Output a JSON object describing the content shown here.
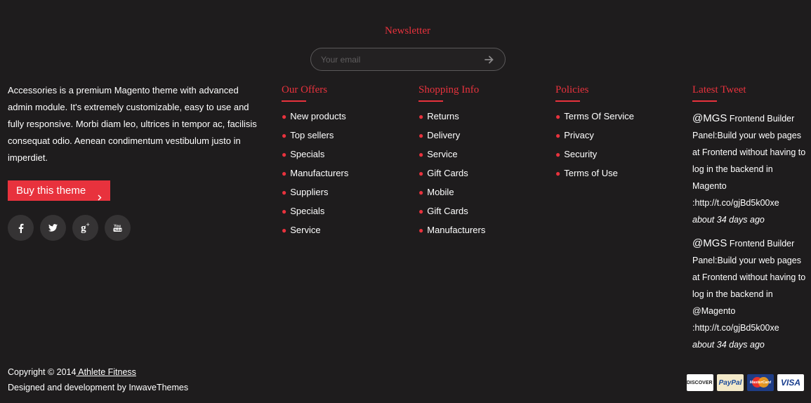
{
  "newsletter": {
    "title": "Newsletter",
    "placeholder": "Your email"
  },
  "about": {
    "text": "Accessories is a premium Magento theme with advanced admin module. It's extremely customizable, easy to use and fully responsive. Morbi diam leo, ultrices in tempor ac, facilisis consequat odio. Aenean condimentum vestibulum justo in imperdiet.",
    "buy_label": "Buy this theme",
    "socials": [
      "facebook-icon",
      "twitter-icon",
      "google-plus-icon",
      "youtube-icon"
    ]
  },
  "offers": {
    "title": "Our Offers",
    "items": [
      "New products",
      "Top sellers",
      "Specials",
      "Manufacturers",
      "Suppliers",
      "Specials",
      "Service"
    ]
  },
  "shopping": {
    "title": "Shopping Info",
    "items": [
      "Returns",
      "Delivery",
      "Service",
      "Gift Cards",
      "Mobile",
      "Gift Cards",
      "Manufacturers"
    ]
  },
  "policies": {
    "title": "Policies",
    "items": [
      "Terms Of Service",
      "Privacy",
      "Security",
      "Terms of Use"
    ]
  },
  "tweets": {
    "title": "Latest Tweet",
    "items": [
      {
        "handle": "@MGS",
        "text": " Frontend Builder Panel:Build your web pages at Frontend without having to log in the backend in Magento :http://t.co/gjBd5k00xe",
        "time": "about 34 days ago"
      },
      {
        "handle": "@MGS",
        "text": " Frontend Builder Panel:Build your web pages at Frontend without having to log in the backend in @Magento :http://t.co/gjBd5k00xe",
        "time": "about 34 days ago"
      }
    ]
  },
  "footer": {
    "copyright_prefix": "Copyright © 2014",
    "brand": " Athlete Fitness",
    "designed": "Designed and development by InwaveThemes",
    "payments": [
      "DISCOVER",
      "PayPal",
      "MasterCard",
      "VISA"
    ]
  },
  "colors": {
    "accent": "#e8323d",
    "background": "#1e1c1d"
  }
}
